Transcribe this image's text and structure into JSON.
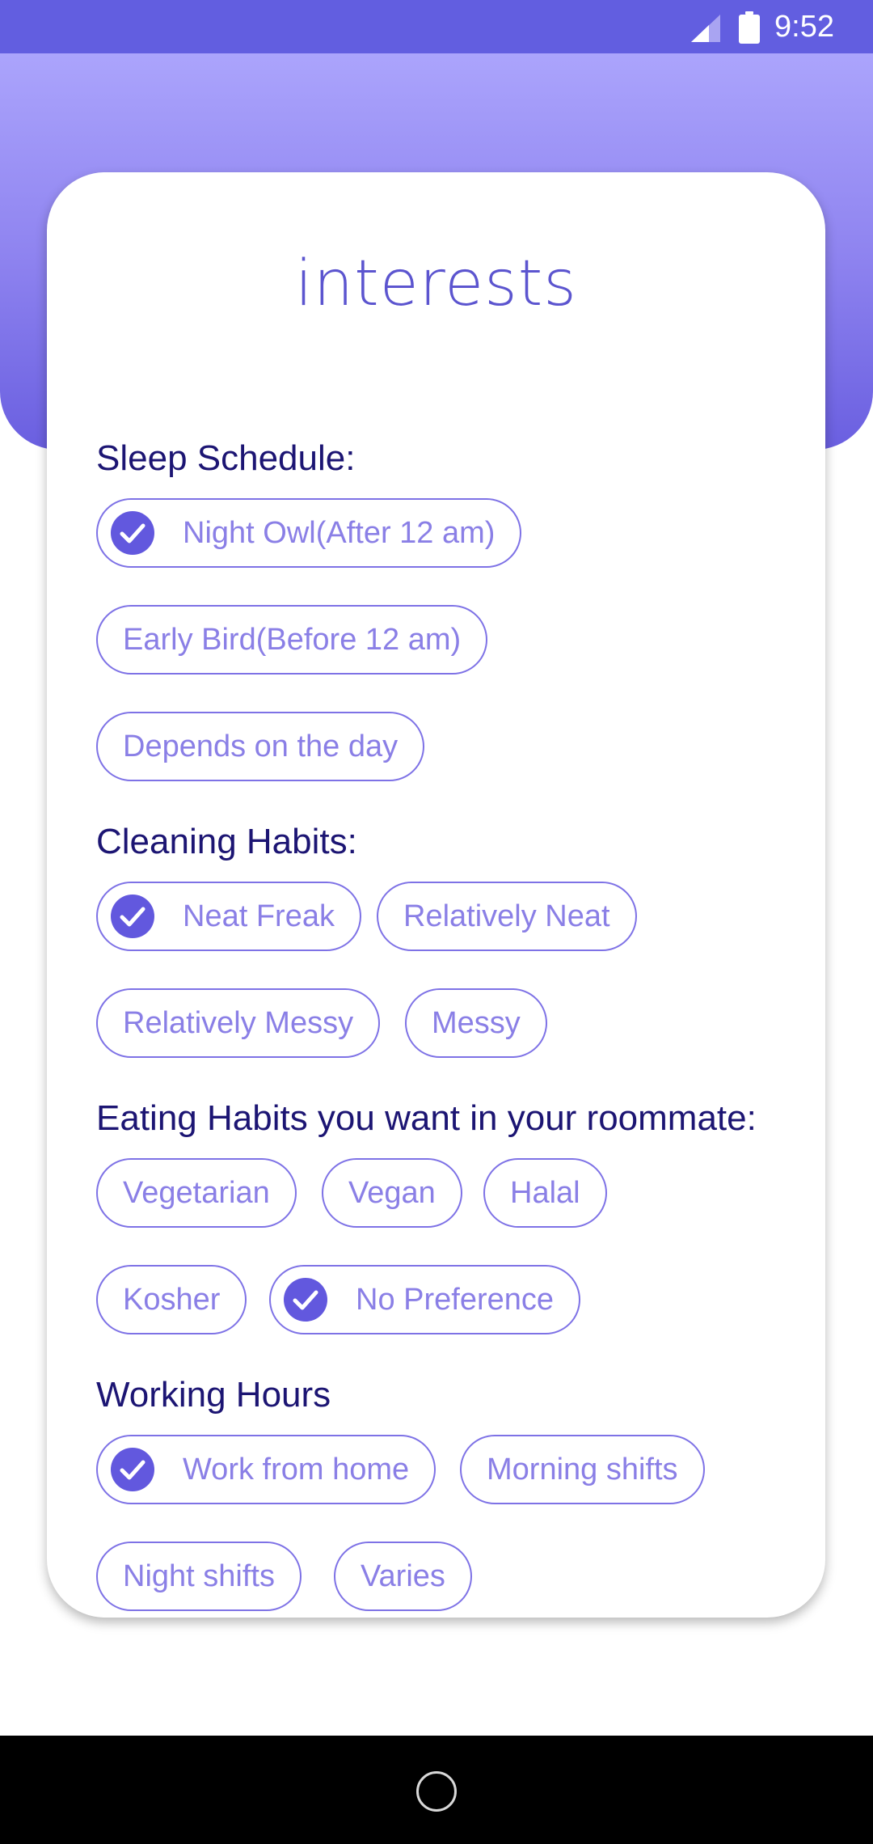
{
  "status_bar": {
    "time": "9:52",
    "icons": [
      "signal-icon",
      "battery-icon"
    ],
    "background": "#625ee0"
  },
  "colors": {
    "header_gradient_top": "#aba4fc",
    "header_gradient_bottom": "#6a5fe0",
    "chip_border": "#7e72e6",
    "chip_text": "#8a7fe6",
    "check_fill": "#6258de",
    "heading_text": "#1c1573",
    "title_text": "#5c55cf"
  },
  "card": {
    "title": "interests"
  },
  "sections": {
    "sleep": {
      "heading": "Sleep Schedule:",
      "options": [
        {
          "label": "Night Owl(After 12 am)",
          "selected": true
        },
        {
          "label": "Early Bird(Before 12 am)",
          "selected": false
        },
        {
          "label": "Depends on the day",
          "selected": false
        }
      ]
    },
    "cleaning": {
      "heading": "Cleaning Habits:",
      "options": [
        {
          "label": "Neat Freak",
          "selected": true
        },
        {
          "label": "Relatively Neat",
          "selected": false
        },
        {
          "label": "Relatively Messy",
          "selected": false
        },
        {
          "label": "Messy",
          "selected": false
        }
      ]
    },
    "eating": {
      "heading": "Eating Habits you want in your roommate:",
      "options": [
        {
          "label": "Vegetarian",
          "selected": false
        },
        {
          "label": "Vegan",
          "selected": false
        },
        {
          "label": "Halal",
          "selected": false
        },
        {
          "label": "Kosher",
          "selected": false
        },
        {
          "label": "No Preference",
          "selected": true
        }
      ]
    },
    "working": {
      "heading": "Working Hours",
      "options": [
        {
          "label": "Work from home",
          "selected": true
        },
        {
          "label": "Morning shifts",
          "selected": false
        },
        {
          "label": "Night shifts",
          "selected": false
        },
        {
          "label": "Varies",
          "selected": false
        }
      ]
    }
  },
  "nav_bar": {
    "icons": [
      "home-button-icon"
    ]
  }
}
